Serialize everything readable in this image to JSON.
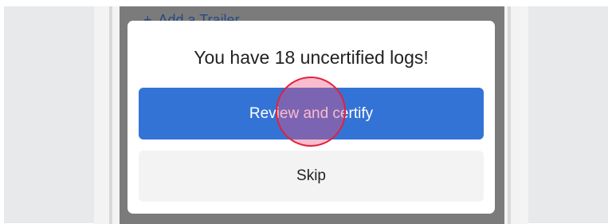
{
  "background": {
    "link_icon": "plus-icon",
    "link_plus": "+",
    "link_label": "Add a Trailer"
  },
  "dialog": {
    "title": "You have 18 uncertified logs!",
    "primary_button": "Review and certify",
    "secondary_button": "Skip"
  },
  "colors": {
    "primary": "#3473d6",
    "overlay": "#7b7b7b",
    "tap_indicator": "#e2213c"
  }
}
